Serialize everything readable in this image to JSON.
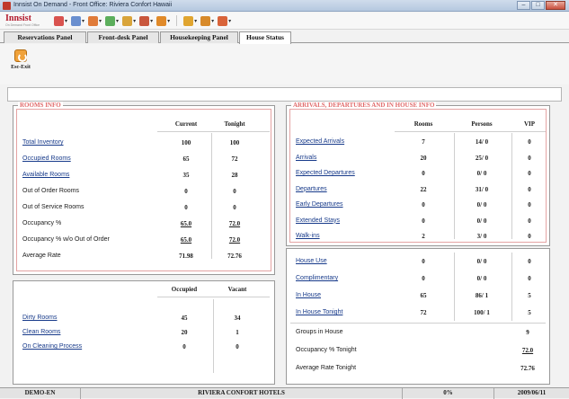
{
  "window": {
    "title": "Innsist On Demand - Front Office: Riviera Confort Hawaii"
  },
  "toolbar": {
    "logo": "Innsist",
    "logo_sub": "On Demand Front Office",
    "icons": [
      {
        "name": "reservations-icon",
        "color": "#d9534f"
      },
      {
        "name": "guests-icon",
        "color": "#6a8fcf"
      },
      {
        "name": "rooms-icon",
        "color": "#e07b39"
      },
      {
        "name": "cashier-icon",
        "color": "#5cae5c"
      },
      {
        "name": "night-audit-icon",
        "color": "#d9a43a"
      },
      {
        "name": "reports-icon",
        "color": "#c9573d"
      },
      {
        "name": "config-icon",
        "color": "#e08a2a"
      },
      {
        "name": "lock-icon",
        "color": "#e0a530"
      },
      {
        "name": "help-icon",
        "color": "#d88a2a"
      },
      {
        "name": "tools-icon",
        "color": "#d9643a"
      }
    ]
  },
  "tabs": [
    {
      "label": "Reservations Panel",
      "active": false
    },
    {
      "label": "Front-desk Panel",
      "active": false
    },
    {
      "label": "Housekeeping Panel",
      "active": false
    },
    {
      "label": "House Status",
      "active": true
    }
  ],
  "actions": {
    "exit_label": "Esc-Exit"
  },
  "rooms_info": {
    "title": "ROOMS INFO",
    "columns": [
      "Current",
      "Tonight"
    ],
    "rows": [
      {
        "label": "Total Inventory",
        "link": true,
        "current": "100",
        "tonight": "100",
        "ul": false
      },
      {
        "label": "Occupied Rooms",
        "link": true,
        "current": "65",
        "tonight": "72",
        "ul": false
      },
      {
        "label": "Available Rooms",
        "link": true,
        "current": "35",
        "tonight": "28",
        "ul": false
      },
      {
        "label": "Out of Order Rooms",
        "link": false,
        "current": "0",
        "tonight": "0",
        "ul": false
      },
      {
        "label": "Out of Service Rooms",
        "link": false,
        "current": "0",
        "tonight": "0",
        "ul": false
      },
      {
        "label": "Occupancy %",
        "link": false,
        "current": "65.0",
        "tonight": "72.0",
        "ul": true
      },
      {
        "label": "Occupancy % w/o Out of Order",
        "link": false,
        "current": "65.0",
        "tonight": "72.0",
        "ul": true
      },
      {
        "label": "Average Rate",
        "link": false,
        "current": "71.98",
        "tonight": "72.76",
        "ul": false
      }
    ]
  },
  "housekeeping": {
    "columns": [
      "Occupied",
      "Vacant"
    ],
    "rows": [
      {
        "label": "Dirty Rooms",
        "occupied": "45",
        "vacant": "34"
      },
      {
        "label": "Clean Rooms",
        "occupied": "20",
        "vacant": "1"
      },
      {
        "label": "On Cleaning Process",
        "occupied": "0",
        "vacant": "0"
      }
    ]
  },
  "arrivals": {
    "title": "ARRIVALS, DEPARTURES AND IN HOUSE INFO",
    "columns": [
      "Rooms",
      "Persons",
      "VIP"
    ],
    "rows": [
      {
        "label": "Expected Arrivals",
        "rooms": "7",
        "persons": "14/ 0",
        "vip": "0"
      },
      {
        "label": "Arrivals",
        "rooms": "20",
        "persons": "25/ 0",
        "vip": "0"
      },
      {
        "label": "Expected Departures",
        "rooms": "0",
        "persons": "0/ 0",
        "vip": "0"
      },
      {
        "label": "Departures",
        "rooms": "22",
        "persons": "31/ 0",
        "vip": "0"
      },
      {
        "label": "Early Departures",
        "rooms": "0",
        "persons": "0/ 0",
        "vip": "0"
      },
      {
        "label": "Extended Stays",
        "rooms": "0",
        "persons": "0/ 0",
        "vip": "0"
      },
      {
        "label": "Walk-ins",
        "rooms": "2",
        "persons": "3/ 0",
        "vip": "0"
      }
    ]
  },
  "in_house": {
    "rows": [
      {
        "label": "House Use",
        "link": true,
        "rooms": "0",
        "persons": "0/ 0",
        "vip": "0"
      },
      {
        "label": "Complimentary",
        "link": true,
        "rooms": "0",
        "persons": "0/ 0",
        "vip": "0"
      },
      {
        "label": "In House",
        "link": true,
        "rooms": "65",
        "persons": "86/ 1",
        "vip": "5"
      },
      {
        "label": "In House Tonight",
        "link": true,
        "rooms": "72",
        "persons": "100/ 1",
        "vip": "5"
      }
    ],
    "summary": [
      {
        "label": "Groups in House",
        "value": "9",
        "ul": false
      },
      {
        "label": "Occupancy % Tonight",
        "value": "72.0",
        "ul": true
      },
      {
        "label": "Average Rate Tonight",
        "value": "72.76",
        "ul": false
      }
    ]
  },
  "status": {
    "user": "DEMO-EN",
    "hotel": "RIVIERA CONFORT HOTELS",
    "progress": "0%",
    "date": "2009/06/11"
  }
}
